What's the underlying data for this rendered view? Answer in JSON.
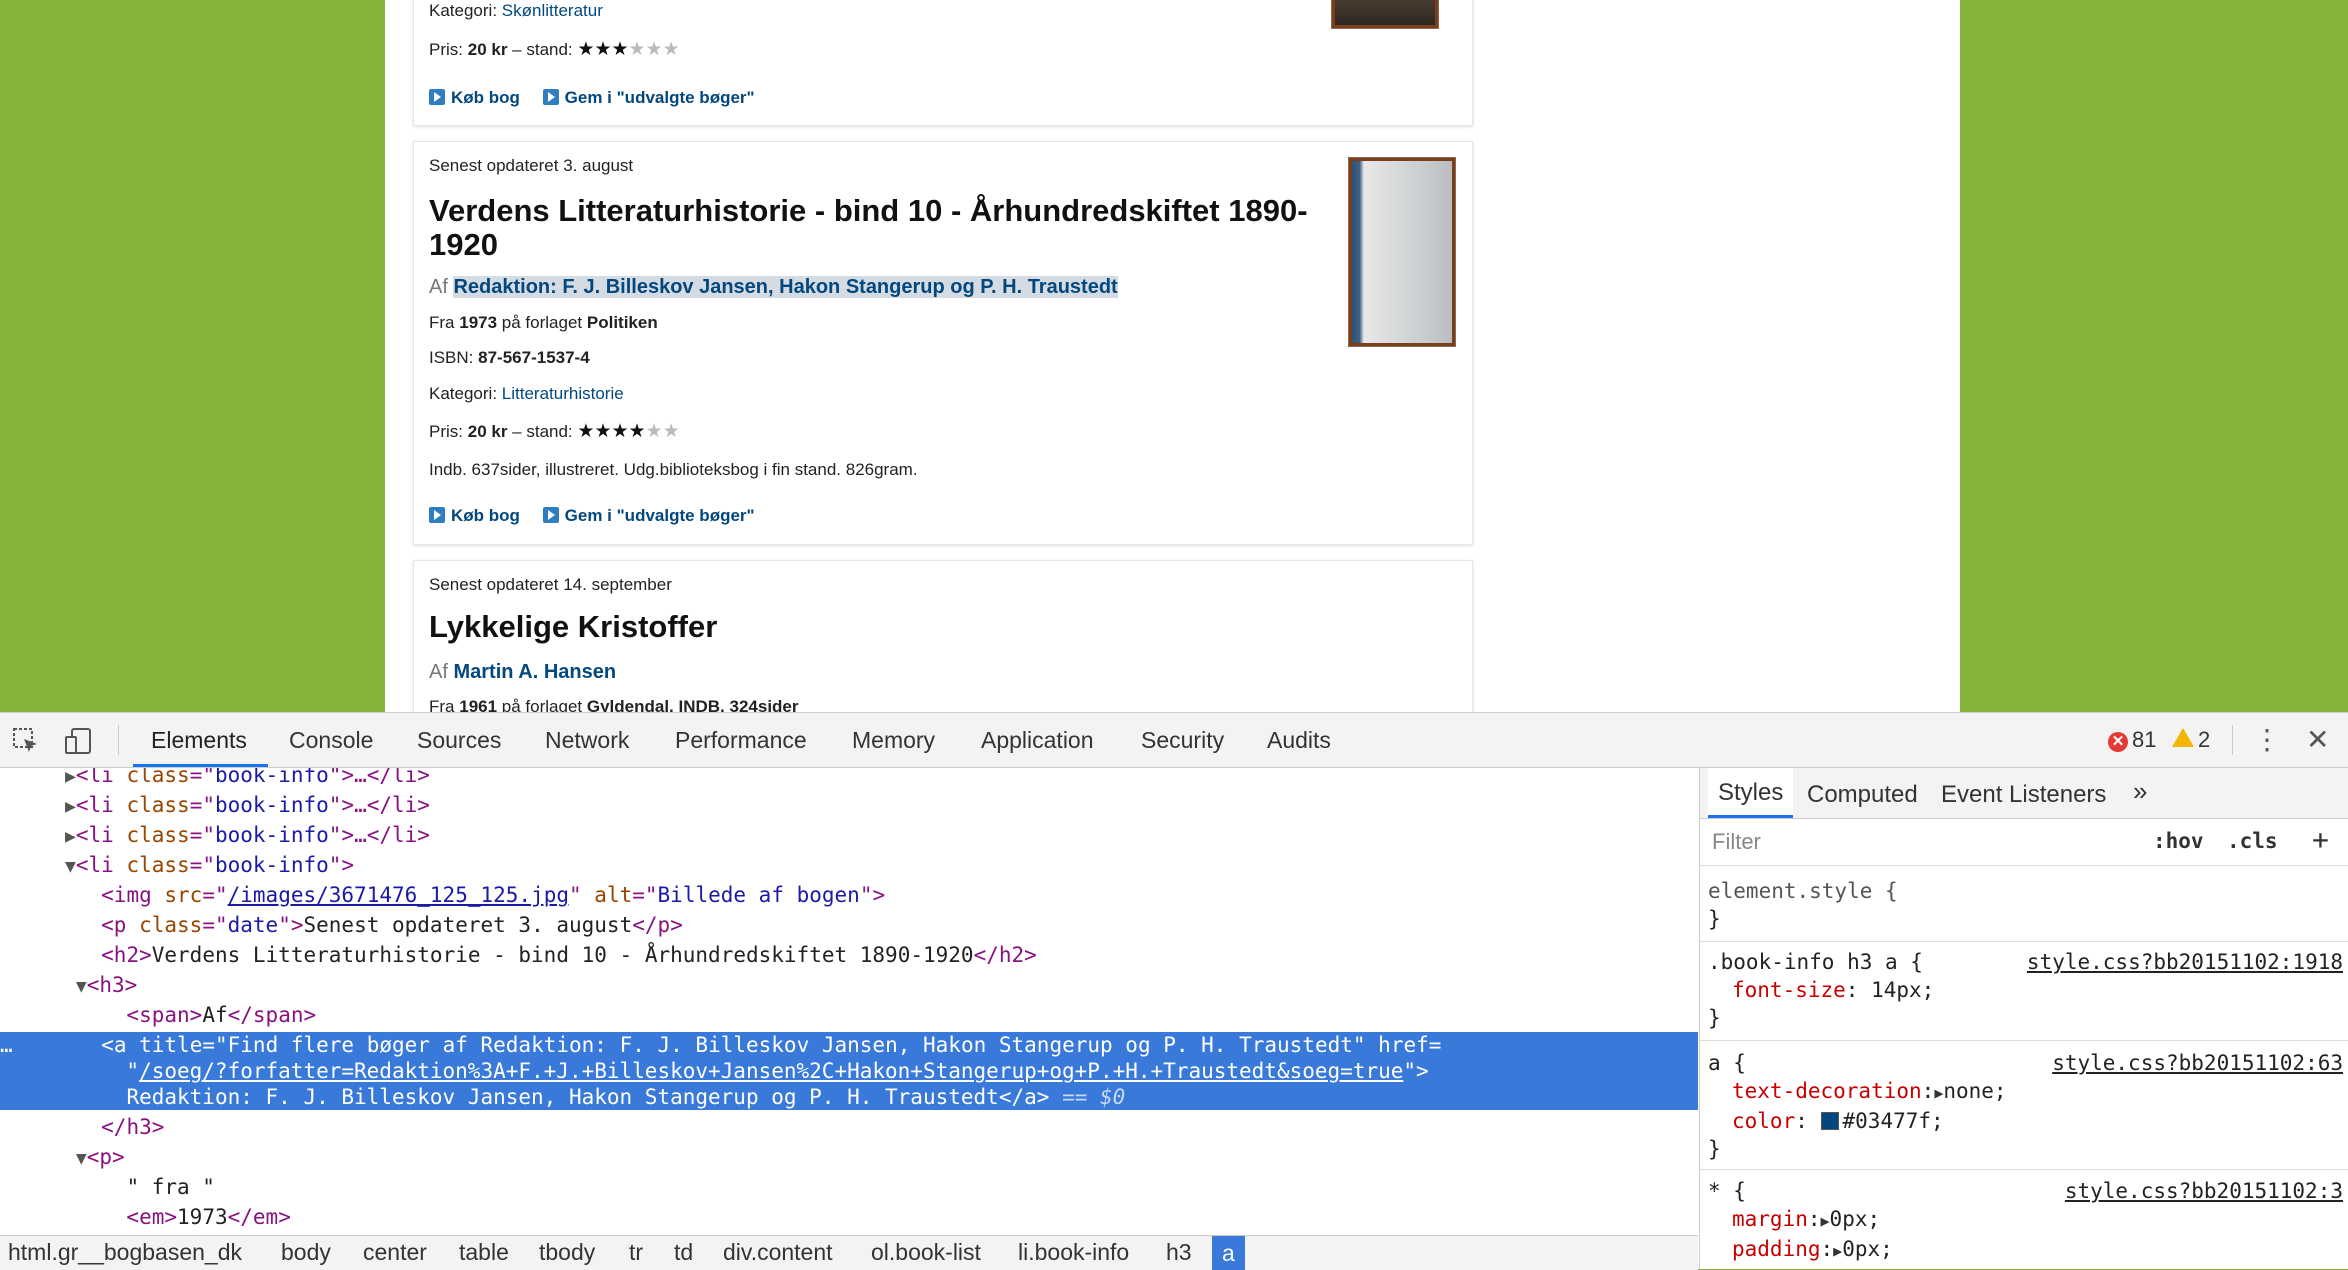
{
  "page": {
    "card0": {
      "category_label": "Kategori:",
      "category_value": "Skønlitteratur",
      "price_prefix": "Pris:",
      "price_value": "20 kr",
      "condition_label": "– stand:",
      "stars_on": "★★★",
      "stars_off": "★★★",
      "buy_label": "Køb bog",
      "save_label": "Gem i \"udvalgte bøger\""
    },
    "card1": {
      "date": "Senest opdateret 3. august",
      "title_line1": "Verdens Litteraturhistorie - bind 10 - Århundredskiftet 1890-",
      "title_line2": "1920",
      "by_prefix": "Af",
      "author": "Redaktion: F. J. Billeskov Jansen, Hakon Stangerup og P. H. Traustedt",
      "from_prefix": "Fra",
      "year": "1973",
      "publisher_prefix": "på forlaget",
      "publisher": "Politiken",
      "isbn_label": "ISBN:",
      "isbn": "87-567-1537-4",
      "category_label": "Kategori:",
      "category_value": "Litteraturhistorie",
      "price_prefix": "Pris:",
      "price_value": "20 kr",
      "condition_label": "– stand:",
      "stars_on": "★★★★",
      "stars_off": "★★",
      "description": "Indb. 637sider, illustreret. Udg.biblioteksbog i fin stand. 826gram.",
      "buy_label": "Køb bog",
      "save_label": "Gem i \"udvalgte bøger\""
    },
    "card2": {
      "date": "Senest opdateret 14. september",
      "title": "Lykkelige Kristoffer",
      "by_prefix": "Af",
      "author": "Martin A. Hansen",
      "from_prefix": "Fra",
      "year": "1961",
      "publisher_prefix": "på forlaget",
      "publisher": "Gyldendal, INDB, 324sider"
    }
  },
  "devtools": {
    "tabs": [
      "Elements",
      "Console",
      "Sources",
      "Network",
      "Performance",
      "Memory",
      "Application",
      "Security",
      "Audits"
    ],
    "error_count": "81",
    "warning_count": "2",
    "elements": {
      "li_tag": "li",
      "class_attr": "class",
      "book_info": "book-info",
      "collapsed_suffix": "…</li>",
      "img_tag": "img",
      "src_attr": "src",
      "img_src": "/images/3671476_125_125.jpg",
      "alt_attr": "alt",
      "img_alt": "Billede af bogen",
      "p_tag": "p",
      "date_class": "date",
      "date_text": "Senest opdateret 3. august",
      "h2_tag": "h2",
      "h2_text": "Verdens Litteraturhistorie - bind 10 - Århundredskiftet 1890-1920",
      "h3_tag": "h3",
      "span_tag": "span",
      "span_text": "Af",
      "a_tag": "a",
      "title_attr": "title",
      "a_title": "Find flere bøger af Redaktion: F. J. Billeskov Jansen, Hakon Stangerup og P. H. Traustedt",
      "href_attr": "href",
      "a_href": "/soeg/?forfatter=Redaktion%3A+F.+J.+Billeskov+Jansen%2C+Hakon+Stangerup+og+P.+H.+Traustedt&soeg=true",
      "a_text": "Redaktion: F. J. Billeskov Jansen, Hakon Stangerup og P. H. Traustedt",
      "dollar_ref": "== $0",
      "p_text": "\" fra \"",
      "em_tag": "em",
      "em_text": "1973"
    },
    "breadcrumbs": [
      "html.gr__bogbasen_dk",
      "body",
      "center",
      "table",
      "tbody",
      "tr",
      "td",
      "div.content",
      "ol.book-list",
      "li.book-info",
      "h3",
      "a"
    ],
    "styles": {
      "tabs": [
        "Styles",
        "Computed",
        "Event Listeners"
      ],
      "filter_placeholder": "Filter",
      "hov": ":hov",
      "cls": ".cls",
      "rules": [
        {
          "selector": "element.style {",
          "close": "}"
        },
        {
          "selector": ".book-info h3 a {",
          "source": "style.css?bb20151102:1918",
          "props": [
            {
              "name": "font-size",
              "value": "14px;"
            }
          ],
          "close": "}"
        },
        {
          "selector": "a {",
          "source": "style.css?bb20151102:63",
          "props": [
            {
              "name": "text-decoration",
              "value": "none;"
            },
            {
              "name": "color",
              "value": "#03477f;"
            }
          ],
          "close": "}"
        },
        {
          "selector": "* {",
          "source": "style.css?bb20151102:3",
          "props": [
            {
              "name": "margin",
              "value": "0px;"
            },
            {
              "name": "padding",
              "value": "0px;"
            }
          ]
        }
      ]
    }
  },
  "colors": {
    "page_bg": "#86b33a",
    "link": "#03477f",
    "selection": "#3879d9"
  }
}
